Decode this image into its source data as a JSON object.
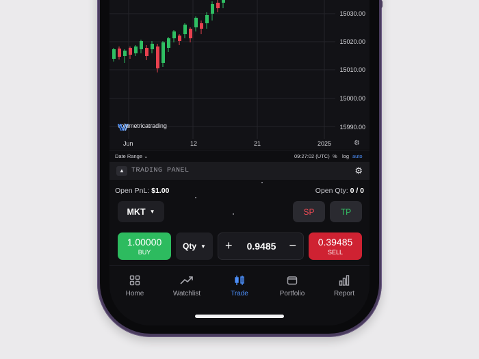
{
  "chart": {
    "price_labels": [
      "15030.00",
      "15020.00",
      "15010.00",
      "15000.00",
      "15990.00"
    ],
    "x_labels": [
      "Jun",
      "12",
      "21",
      "2025"
    ],
    "brand": "volumetricatrading",
    "icons": {
      "settings": "gear-icon"
    }
  },
  "range_bar": {
    "date_range": "Date Range",
    "time": "09:27:02 (UTC)",
    "pct": "%",
    "log": "log",
    "auto": "auto"
  },
  "panel": {
    "title": "TRADING PANEL",
    "open_pnl_label": "Open PnL:",
    "open_pnl_value": "$1.00",
    "open_qty_label": "Open Qty:",
    "open_qty_value": "0 / 0",
    "order_type": "MKT",
    "sp_label": "SP",
    "tp_label": "TP",
    "buy_price": "1.00000",
    "buy_label": "BUY",
    "qty_label": "Qty",
    "qty_value": "0.9485",
    "plus": "+",
    "minus": "−",
    "sell_price": "0.39485",
    "sell_label": "SELL"
  },
  "tabs": [
    {
      "label": "Home",
      "icon": "grid-icon",
      "active": false
    },
    {
      "label": "Watchlist",
      "icon": "trend-up-icon",
      "active": false
    },
    {
      "label": "Trade",
      "icon": "candles-icon",
      "active": true
    },
    {
      "label": "Portfolio",
      "icon": "wallet-icon",
      "active": false
    },
    {
      "label": "Report",
      "icon": "bar-chart-icon",
      "active": false
    }
  ],
  "colors": {
    "accent": "#4b8df7",
    "buy": "#2dbb5f",
    "sell": "#cf2232",
    "candle_up": "#2fbf63",
    "candle_down": "#e8414f",
    "phone_frame": "#4a3c5e"
  }
}
